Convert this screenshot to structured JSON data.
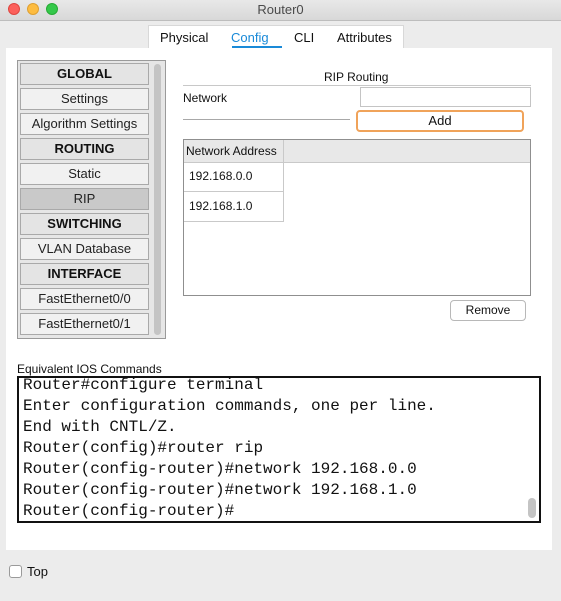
{
  "window": {
    "title": "Router0"
  },
  "tabs": [
    {
      "label": "Physical"
    },
    {
      "label": "Config",
      "active": true
    },
    {
      "label": "CLI"
    },
    {
      "label": "Attributes"
    }
  ],
  "sidebar": {
    "items": [
      {
        "label": "GLOBAL",
        "header": true
      },
      {
        "label": "Settings"
      },
      {
        "label": "Algorithm Settings"
      },
      {
        "label": "ROUTING",
        "header": true
      },
      {
        "label": "Static"
      },
      {
        "label": "RIP",
        "selected": true
      },
      {
        "label": "SWITCHING",
        "header": true
      },
      {
        "label": "VLAN Database"
      },
      {
        "label": "INTERFACE",
        "header": true
      },
      {
        "label": "FastEthernet0/0"
      },
      {
        "label": "FastEthernet0/1"
      }
    ]
  },
  "rip": {
    "title": "RIP Routing",
    "network_label": "Network",
    "network_value": "",
    "add_label": "Add",
    "table_header": "Network Address",
    "networks": [
      "192.168.0.0",
      "192.168.1.0"
    ],
    "remove_label": "Remove"
  },
  "ios": {
    "label": "Equivalent IOS Commands",
    "lines": [
      "Router#configure terminal",
      "Enter configuration commands, one per line.",
      "End with CNTL/Z.",
      "Router(config)#router rip",
      "Router(config-router)#network 192.168.0.0",
      "Router(config-router)#network 192.168.1.0",
      "Router(config-router)#"
    ]
  },
  "footer": {
    "top_label": "Top",
    "top_checked": false
  },
  "colors": {
    "accent": "#1a8ad8",
    "focus_ring": "#f0a35a"
  }
}
